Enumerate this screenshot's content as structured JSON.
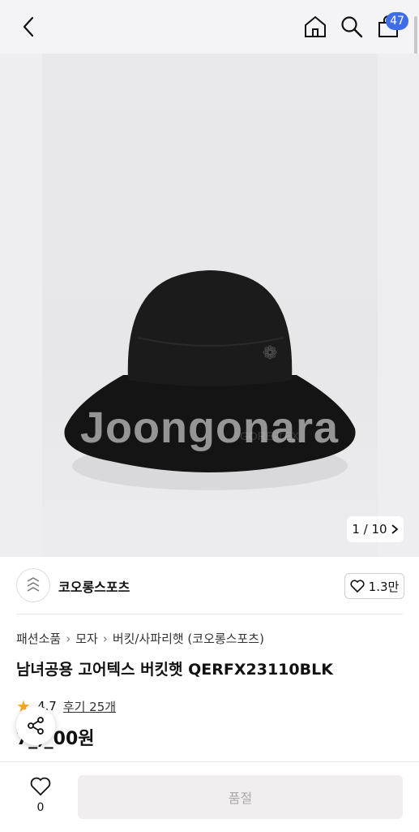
{
  "header": {
    "cart_count": "47"
  },
  "gallery": {
    "watermark": "Joongonara",
    "pager": "1 / 10"
  },
  "seller": {
    "name": "코오롱스포츠",
    "like_count": "1.3만"
  },
  "breadcrumb": [
    "패션소품",
    "모자",
    "버킷/사파리햇 (코오롱스포츠)"
  ],
  "product": {
    "title": "남녀공용 고어텍스 버킷햇 QERFX23110BLK",
    "rating": "4.7",
    "reviews": "후기 25개",
    "price": "7_,_00원"
  },
  "bottom": {
    "wish_count": "0",
    "buy_label": "품절"
  },
  "colors": {
    "accent": "#3f6de8",
    "star": "#f5a623",
    "soldout_bg": "#f1eef0"
  }
}
